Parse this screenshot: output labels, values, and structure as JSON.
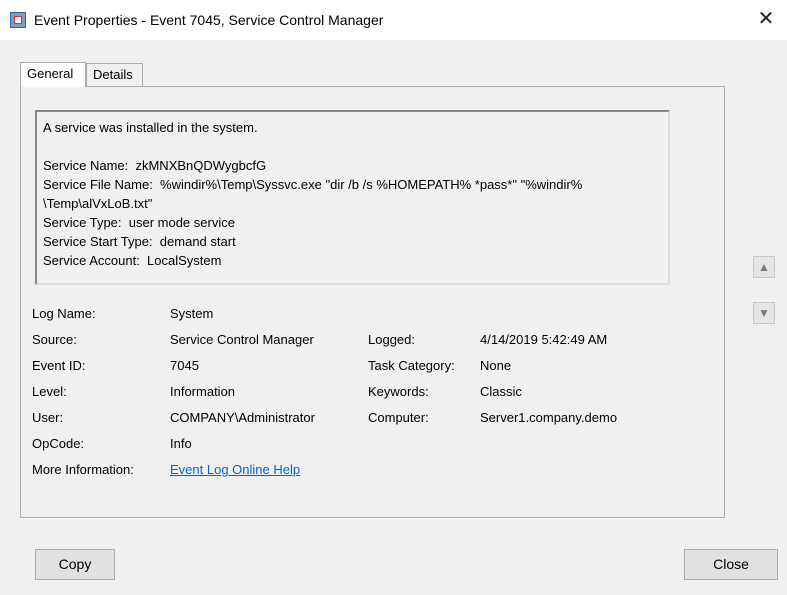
{
  "window": {
    "title": "Event Properties - Event 7045, Service Control Manager",
    "close_glyph": "✕"
  },
  "tabs": [
    {
      "label": "General",
      "active": true
    },
    {
      "label": "Details",
      "active": false
    }
  ],
  "description": {
    "lines": [
      "A service was installed in the system.",
      "",
      "Service Name:  zkMNXBnQDWygbcfG",
      "Service File Name:  %windir%\\Temp\\Syssvc.exe \"dir /b /s %HOMEPATH% *pass*\" \"%windir%",
      "\\Temp\\alVxLoB.txt\"",
      "Service Type:  user mode service",
      "Service Start Type:  demand start",
      "Service Account:  LocalSystem"
    ]
  },
  "scroll": {
    "up_glyph": "▲",
    "down_glyph": "▼"
  },
  "properties": {
    "log_name_label": "Log Name:",
    "log_name_value": "System",
    "source_label": "Source:",
    "source_value": "Service Control Manager",
    "logged_label": "Logged:",
    "logged_value": "4/14/2019 5:42:49 AM",
    "event_id_label": "Event ID:",
    "event_id_value": "7045",
    "task_category_label": "Task Category:",
    "task_category_value": "None",
    "level_label": "Level:",
    "level_value": "Information",
    "keywords_label": "Keywords:",
    "keywords_value": "Classic",
    "user_label": "User:",
    "user_value": "COMPANY\\Administrator",
    "computer_label": "Computer:",
    "computer_value": "Server1.company.demo",
    "opcode_label": "OpCode:",
    "opcode_value": "Info",
    "more_info_label": "More Information:",
    "more_info_link": "Event Log Online Help"
  },
  "buttons": {
    "copy": "Copy",
    "close": "Close"
  },
  "colors": {
    "link": "#0066cc",
    "background": "#f0f0f0"
  }
}
